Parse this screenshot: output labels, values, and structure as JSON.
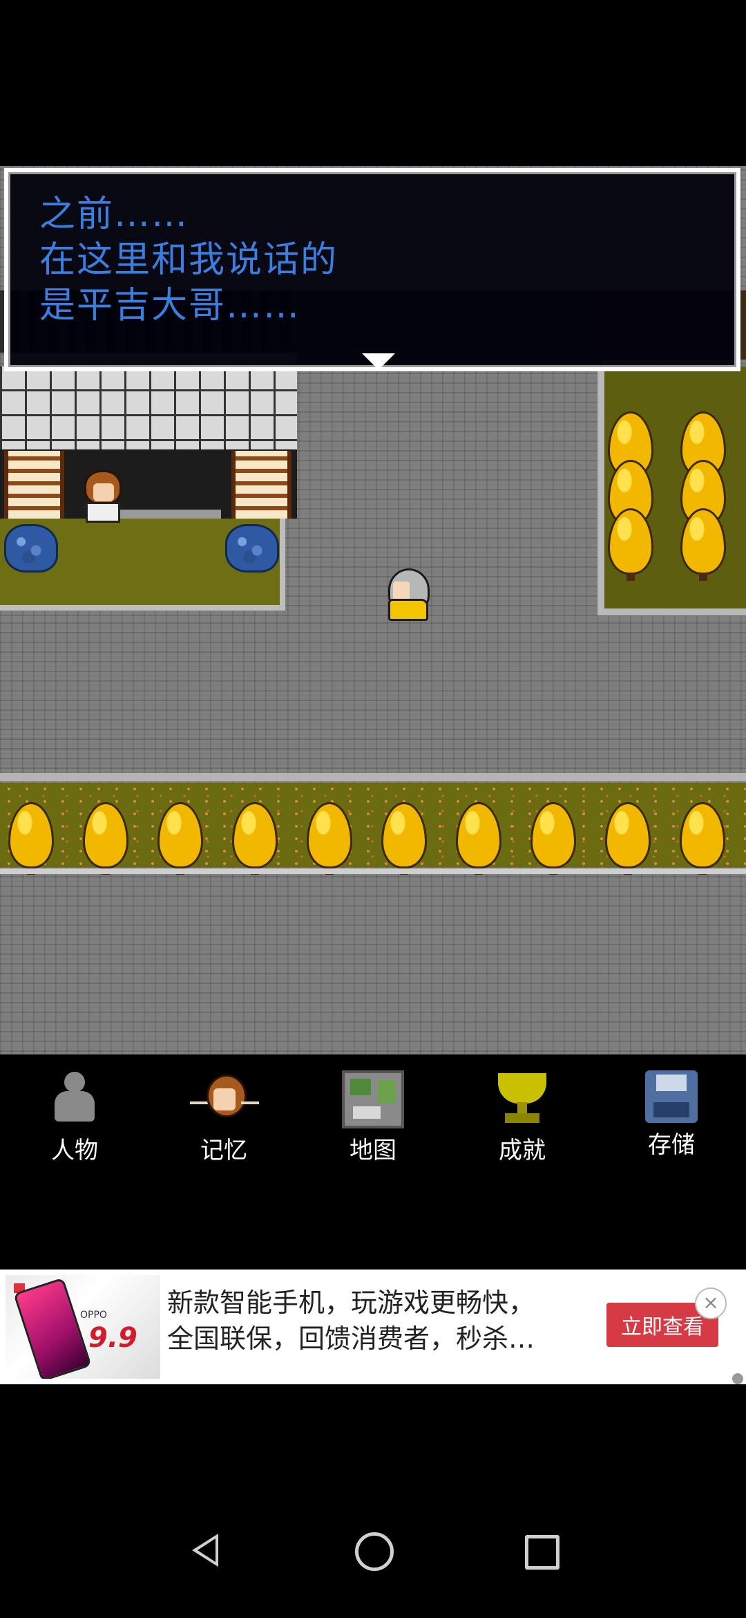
{
  "dialogue": {
    "lines": [
      "之前……",
      "在这里和我说话的",
      "是平吉大哥……"
    ]
  },
  "menu": {
    "items": [
      {
        "label": "人物",
        "icon": "person-icon"
      },
      {
        "label": "记忆",
        "icon": "memory-icon"
      },
      {
        "label": "地图",
        "icon": "map-icon"
      },
      {
        "label": "成就",
        "icon": "trophy-icon"
      },
      {
        "label": "存储",
        "icon": "save-icon"
      }
    ]
  },
  "ad": {
    "line1": "新款智能手机，玩游戏更畅快，",
    "line2": "全国联保，回馈消费者，秒杀…",
    "cta": "立即查看",
    "thumb_brand": "OPPO",
    "thumb_price": "9.9",
    "close_glyph": "×"
  },
  "colors": {
    "dialogue_text": "#3a7fe0",
    "ad_cta": "#d63a45"
  }
}
